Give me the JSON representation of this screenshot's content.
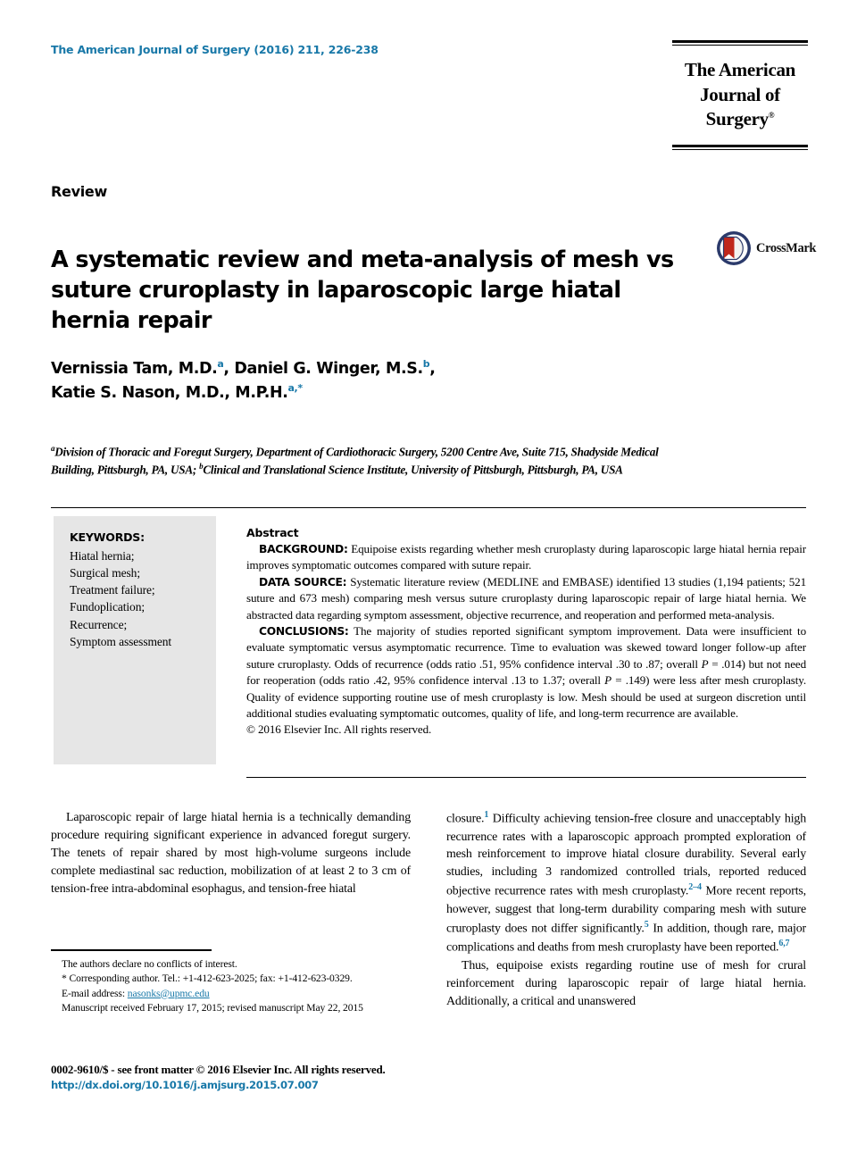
{
  "header": {
    "journal_reference": "The American Journal of Surgery (2016) 211, 226-238",
    "logo_line1": "The American",
    "logo_line2": "Journal of Surgery",
    "logo_trademark": "®"
  },
  "article": {
    "section_label": "Review",
    "title": "A systematic review and meta-analysis of mesh vs suture cruroplasty in laparoscopic large hiatal hernia repair",
    "crossmark_label": "CrossMark",
    "authors_line1_name1": "Vernissia Tam, M.D.",
    "authors_line1_sup1": "a",
    "authors_line1_name2": ", Daniel G. Winger, M.S.",
    "authors_line1_sup2": "b",
    "authors_line1_tail": ",",
    "authors_line2_name": "Katie S. Nason, M.D., M.P.H.",
    "authors_line2_sup": "a,*",
    "affiliation_a_sup": "a",
    "affiliation_a": "Division of Thoracic and Foregut Surgery, Department of Cardiothoracic Surgery, 5200 Centre Ave, Suite 715, Shadyside Medical Building, Pittsburgh, PA, USA;",
    "affiliation_b_sup": "b",
    "affiliation_b": "Clinical and Translational Science Institute, University of Pittsburgh, Pittsburgh, PA, USA"
  },
  "keywords": {
    "title": "KEYWORDS:",
    "items": [
      "Hiatal hernia;",
      "Surgical mesh;",
      "Treatment failure;",
      "Fundoplication;",
      "Recurrence;",
      "Symptom assessment"
    ]
  },
  "abstract": {
    "title": "Abstract",
    "background_label": "BACKGROUND:",
    "background_text": "Equipoise exists regarding whether mesh cruroplasty during laparoscopic large hiatal hernia repair improves symptomatic outcomes compared with suture repair.",
    "data_source_label": "DATA SOURCE:",
    "data_source_text": "Systematic literature review (MEDLINE and EMBASE) identified 13 studies (1,194 patients; 521 suture and 673 mesh) comparing mesh versus suture cruroplasty during laparoscopic repair of large hiatal hernia. We abstracted data regarding symptom assessment, objective recurrence, and reoperation and performed meta-analysis.",
    "conclusions_label": "CONCLUSIONS:",
    "conclusions_part1": "The majority of studies reported significant symptom improvement. Data were insufficient to evaluate symptomatic versus asymptomatic recurrence. Time to evaluation was skewed toward longer follow-up after suture cruroplasty. Odds of recurrence (odds ratio .51, 95% confidence interval .30 to .87; overall ",
    "conclusions_p1": "P",
    "conclusions_part2": " = .014) but not need for reoperation (odds ratio .42, 95% confidence interval .13 to 1.37; overall ",
    "conclusions_p2": "P",
    "conclusions_part3": " = .149) were less after mesh cruroplasty. Quality of evidence supporting routine use of mesh cruroplasty is low. Mesh should be used at surgeon discretion until additional studies evaluating symptomatic outcomes, quality of life, and long-term recurrence are available.",
    "copyright": "© 2016 Elsevier Inc. All rights reserved."
  },
  "body": {
    "left_para1": "Laparoscopic repair of large hiatal hernia is a technically demanding procedure requiring significant experience in advanced foregut surgery. The tenets of repair shared by most high-volume surgeons include complete mediastinal sac reduction, mobilization of at least 2 to 3 cm of tension-free intra-abdominal esophagus, and tension-free hiatal",
    "right_para1_a": "closure.",
    "right_para1_ref1": "1",
    "right_para1_b": " Difficulty achieving tension-free closure and unacceptably high recurrence rates with a laparoscopic approach prompted exploration of mesh reinforcement to improve hiatal closure durability. Several early studies, including 3 randomized controlled trials, reported reduced objective recurrence rates with mesh cruroplasty.",
    "right_para1_ref2": "2–4",
    "right_para1_c": " More recent reports, however, suggest that long-term durability comparing mesh with suture cruroplasty does not differ significantly.",
    "right_para1_ref3": "5",
    "right_para1_d": " In addition, though rare, major complications and deaths from mesh cruroplasty have been reported.",
    "right_para1_ref4": "6,7",
    "right_para2": "Thus, equipoise exists regarding routine use of mesh for crural reinforcement during laparoscopic repair of large hiatal hernia. Additionally, a critical and unanswered"
  },
  "footnotes": {
    "conflicts": "The authors declare no conflicts of interest.",
    "corresponding": "* Corresponding author. Tel.: +1-412-623-2025; fax: +1-412-623-0329.",
    "email_label": "E-mail address:",
    "email_value": "nasonks@upmc.edu",
    "manuscript_dates": "Manuscript received February 17, 2015; revised manuscript May 22, 2015"
  },
  "footer": {
    "issn_line": "0002-9610/$ - see front matter © 2016 Elsevier Inc. All rights reserved.",
    "doi_line": "http://dx.doi.org/10.1016/j.amjsurg.2015.07.007"
  },
  "colors": {
    "accent_blue": "#1878a8",
    "keywords_bg": "#e6e6e6",
    "crossmark_circle": "#2b3a6b",
    "crossmark_red": "#c0271c"
  }
}
